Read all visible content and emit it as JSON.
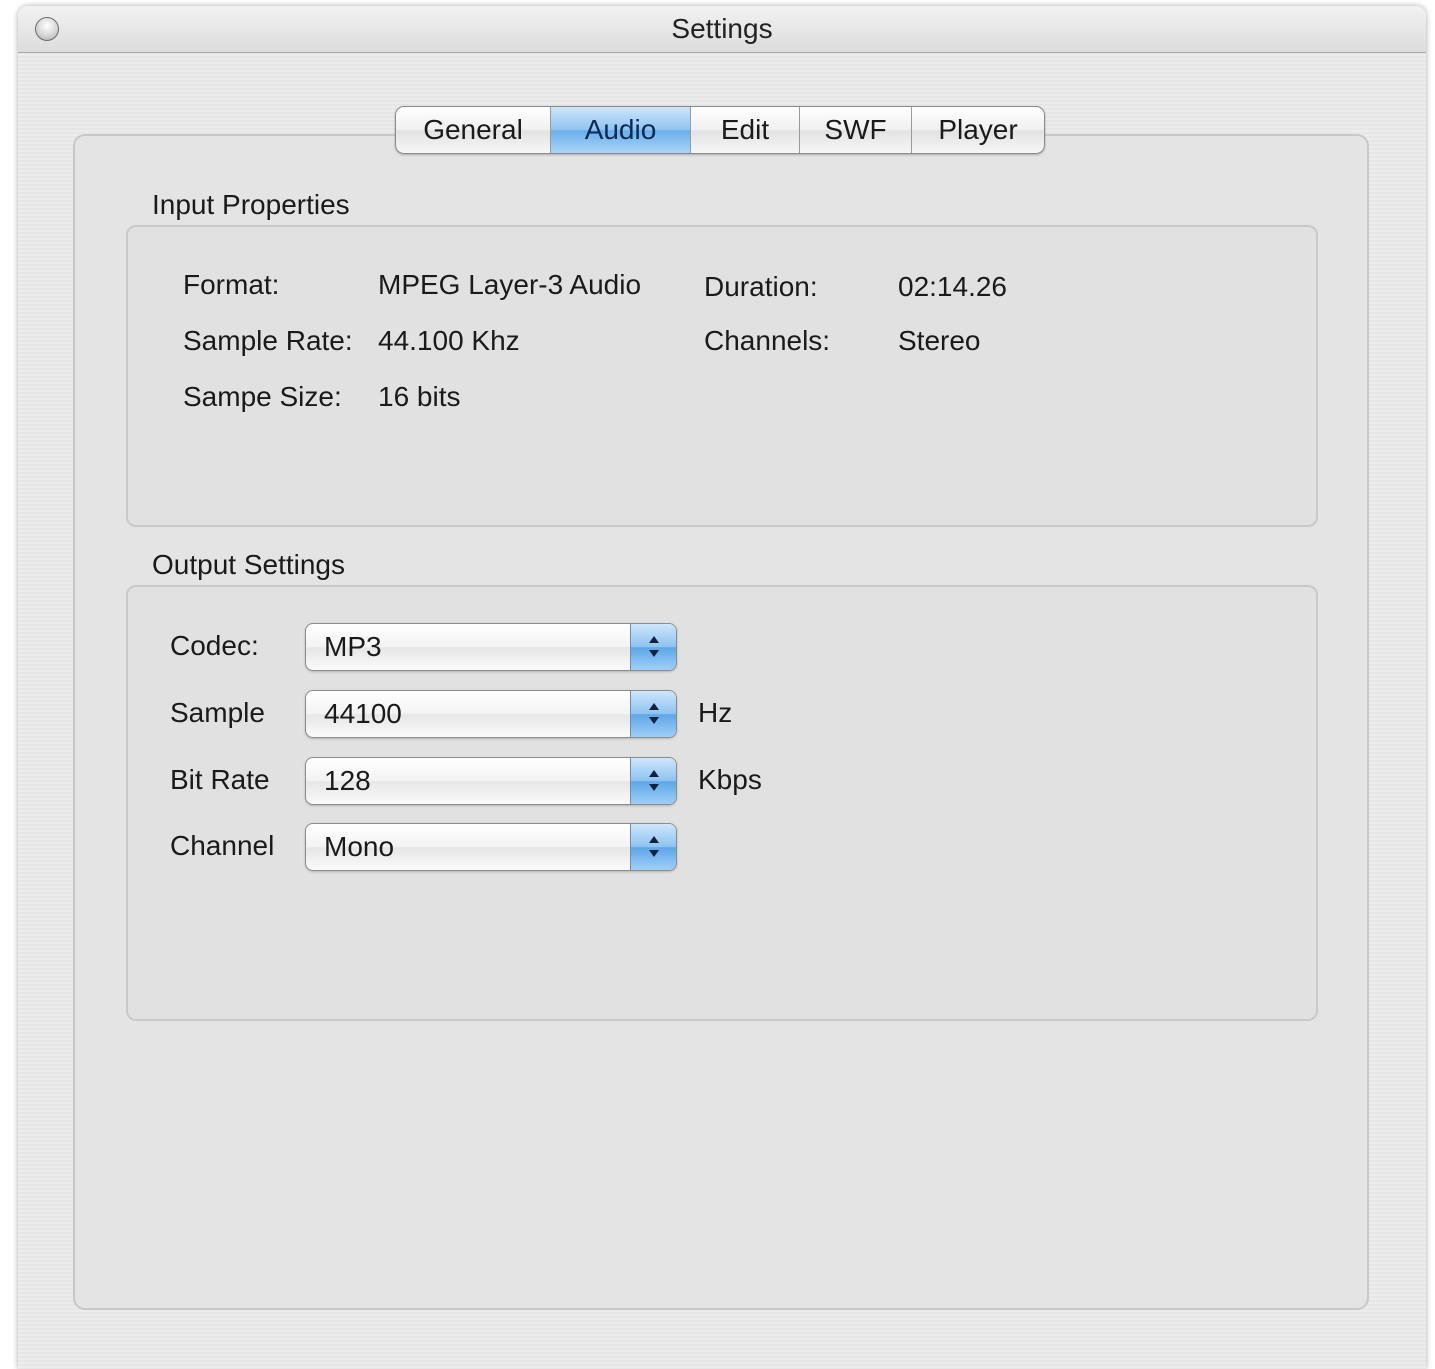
{
  "window": {
    "title": "Settings"
  },
  "tabs": [
    {
      "label": "General",
      "active": false
    },
    {
      "label": "Audio",
      "active": true
    },
    {
      "label": "Edit",
      "active": false
    },
    {
      "label": "SWF",
      "active": false
    },
    {
      "label": "Player",
      "active": false
    }
  ],
  "input_properties": {
    "title": "Input Properties",
    "format_label": "Format:",
    "format_value": "MPEG Layer-3 Audio",
    "sample_rate_label": "Sample Rate:",
    "sample_rate_value": "44.100 Khz",
    "sample_size_label": "Sampe Size:",
    "sample_size_value": "16 bits",
    "duration_label": "Duration:",
    "duration_value": "02:14.26",
    "channels_label": "Channels:",
    "channels_value": "Stereo"
  },
  "output_settings": {
    "title": "Output Settings",
    "codec_label": "Codec:",
    "codec_value": "MP3",
    "sample_label": "Sample",
    "sample_value": "44100",
    "sample_unit": "Hz",
    "bitrate_label": "Bit Rate",
    "bitrate_value": "128",
    "bitrate_unit": "Kbps",
    "channel_label": "Channel",
    "channel_value": "Mono"
  },
  "colors": {
    "accent": "#6aaeeb",
    "window_bg": "#e8e8e8"
  }
}
